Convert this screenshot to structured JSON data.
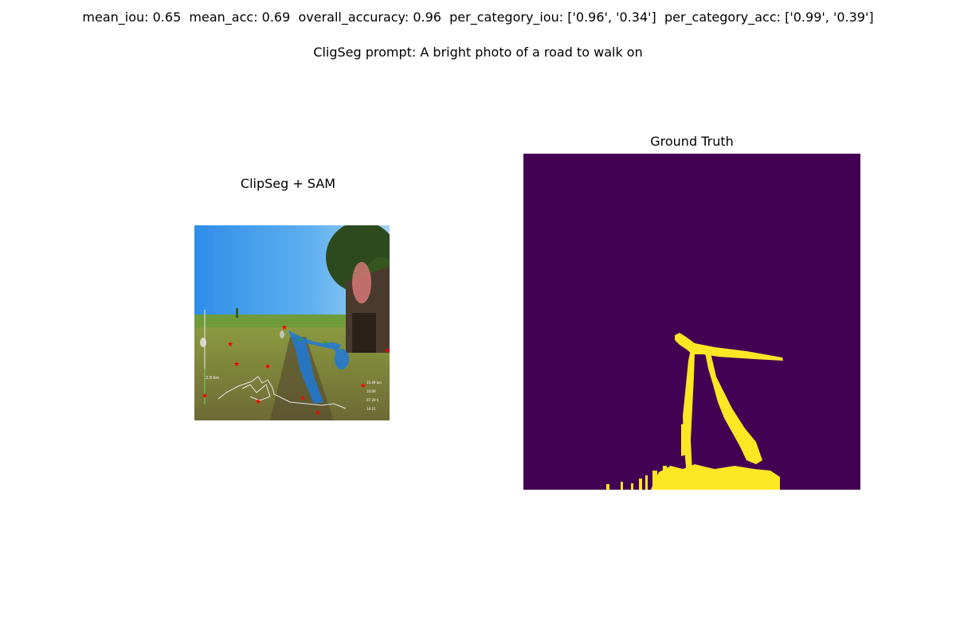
{
  "header": {
    "metrics_line": "mean_iou: 0.65  mean_acc: 0.69  overall_accuracy: 0.96  per_category_iou: ['0.96', '0.34']  per_category_acc: ['0.99', '0.39']",
    "prompt_line": "CligSeg prompt: A bright photo of a road to walk on"
  },
  "left_panel": {
    "title": "ClipSeg + SAM",
    "overlay_labels": [
      "2.9 km",
      "10.49 km",
      "10:09",
      "07:20 h",
      "14:21"
    ],
    "mask_color": "#1e78d8",
    "point_color": "#ff0000",
    "positive_point_color": "#2ca02c"
  },
  "right_panel": {
    "title": "Ground Truth",
    "colors": {
      "background": "#440154",
      "foreground": "#fde725"
    }
  }
}
